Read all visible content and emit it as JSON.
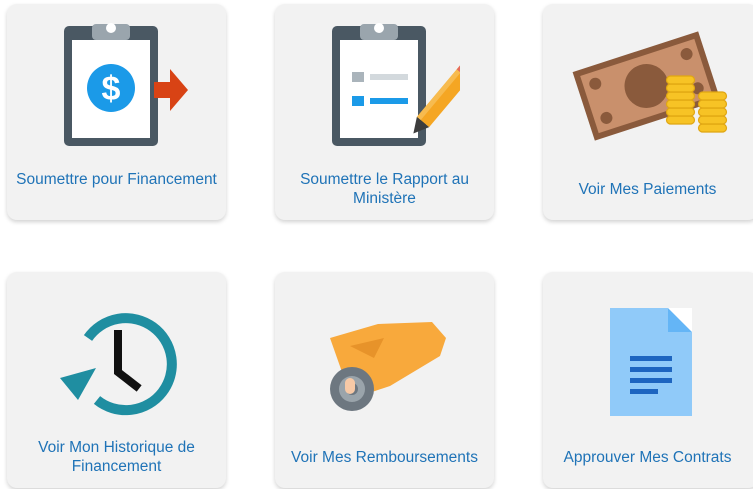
{
  "tiles": [
    {
      "label": "Soumettre pour Financement",
      "icon": "clipboard-dollar-icon"
    },
    {
      "label": "Soumettre le Rapport au Ministère",
      "icon": "clipboard-checklist-pencil-icon"
    },
    {
      "label": "Voir Mes Paiements",
      "icon": "money-bill-coins-icon"
    },
    {
      "label": "Voir Mon Historique de Financement",
      "icon": "history-clock-icon"
    },
    {
      "label": "Voir Mes Remboursements",
      "icon": "hand-coin-icon"
    },
    {
      "label": "Approuver Mes Contrats",
      "icon": "document-icon"
    }
  ],
  "colors": {
    "tile_bg": "#f2f2f2",
    "label": "#1f73b7",
    "clipboard_frame": "#4a5863",
    "dollar_circle": "#1b9ae8",
    "arrow": "#d84315",
    "pencil": "#f5a623",
    "bill": "#c9906c",
    "coin": "#f7c325",
    "clock_arrow": "#1f8ea1",
    "hand": "#f8a93c",
    "document": "#90caf9"
  }
}
